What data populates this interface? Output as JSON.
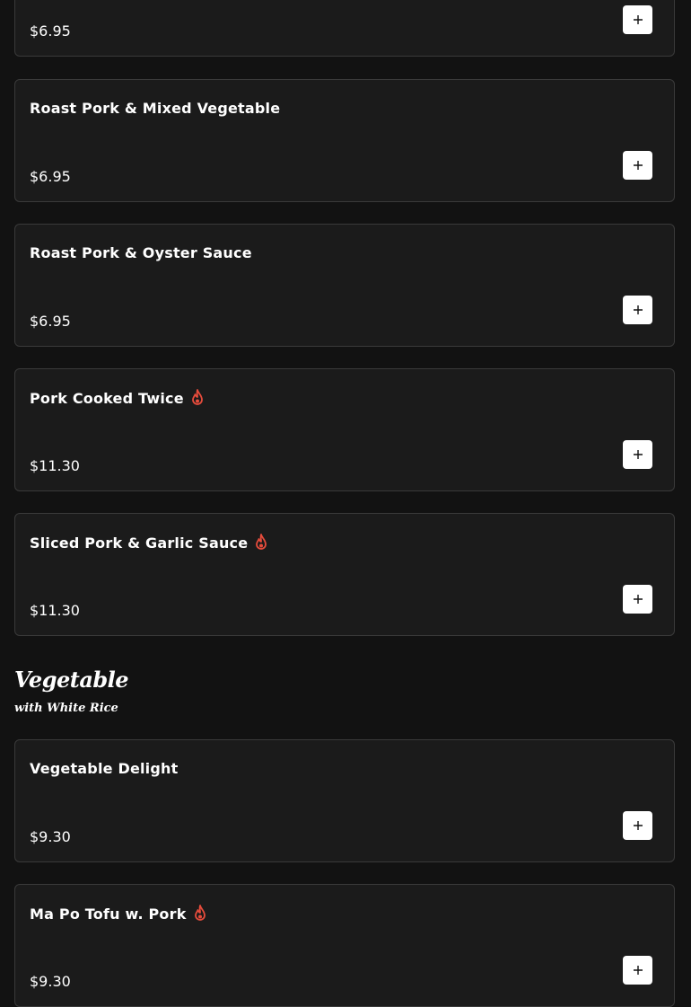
{
  "colors": {
    "background": "#121212",
    "card": "#1b1b1b",
    "border": "#3a3a3a",
    "spicy": "#e74c3c",
    "button": "#ffffff"
  },
  "items_top": [
    {
      "name": "",
      "price": "$6.95",
      "spicy": false
    },
    {
      "name": "Roast Pork & Mixed Vegetable",
      "price": "$6.95",
      "spicy": false
    },
    {
      "name": "Roast Pork & Oyster Sauce",
      "price": "$6.95",
      "spicy": false
    },
    {
      "name": "Pork Cooked Twice",
      "price": "$11.30",
      "spicy": true
    },
    {
      "name": "Sliced Pork & Garlic Sauce",
      "price": "$11.30",
      "spicy": true
    }
  ],
  "section": {
    "title": "Vegetable",
    "subtitle": "with White Rice"
  },
  "items_veg": [
    {
      "name": "Vegetable Delight",
      "price": "$9.30",
      "spicy": false
    },
    {
      "name": "Ma Po Tofu w. Pork",
      "price": "$9.30",
      "spicy": true
    }
  ],
  "icons": {
    "add": "plus-icon",
    "spicy": "flame-icon"
  }
}
